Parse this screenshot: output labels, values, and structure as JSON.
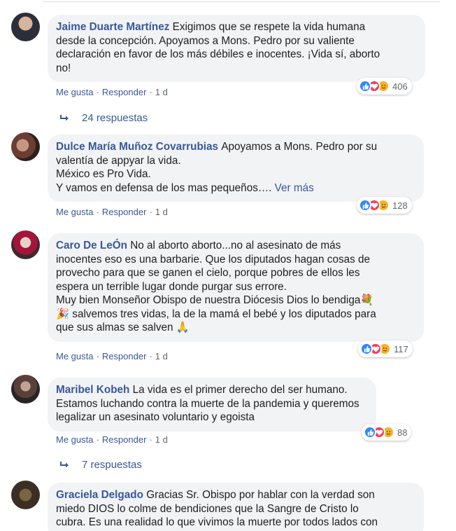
{
  "comments": [
    {
      "author": "Jaime Duarte Martínez",
      "lines": [
        "Exigimos que se respete la vida humana",
        "desde la concepción. Apoyamos a Mons. Pedro por su valiente",
        "declaración en favor de los más débiles e inocentes. ¡Vida sí, aborto",
        "no!"
      ],
      "like_label": "Me gusta",
      "reply_label": "Responder",
      "time": "1 d",
      "reaction_count": "406",
      "replies_label": "24 respuestas"
    },
    {
      "author": "Dulce María Muñoz Covarrubias",
      "lines": [
        "Apoyamos a Mons. Pedro por su",
        "valentía de appyar la vida.",
        "México es Pro Vida.",
        "Y vamos en defensa de los mas pequeños…."
      ],
      "see_more": "Ver más",
      "like_label": "Me gusta",
      "reply_label": "Responder",
      "time": "1 d",
      "reaction_count": "128"
    },
    {
      "author": "Caro De LeÓn",
      "lines": [
        "No al aborto aborto...no al asesinato de más",
        "inocentes eso es una barbarie. Que los diputados hagan cosas de",
        "provecho para que se ganen el cielo, porque pobres de ellos les",
        "espera un terrible lugar donde purgar sus errore.",
        "Muy bien Monseñor Obispo de nuestra Diócesis Dios lo bendiga💐",
        "🎉 salvemos tres vidas, la de la mamá el bebé y los diputados para",
        "que sus almas se salven 🙏"
      ],
      "like_label": "Me gusta",
      "reply_label": "Responder",
      "time": "1 d",
      "reaction_count": "117"
    },
    {
      "author": "Maribel Kobeh",
      "lines": [
        "La vida es el primer derecho del ser humano.",
        "Estamos luchando contra la muerte de la pandemia y queremos",
        "legalizar un asesinato voluntario y egoista"
      ],
      "like_label": "Me gusta",
      "reply_label": "Responder",
      "time": "1 d",
      "reaction_count": "88",
      "replies_label": "7 respuestas"
    },
    {
      "author": "Graciela Delgado",
      "lines": [
        "Gracias Sr. Obispo por hablar con la verdad son",
        "miedo DIOS lo colme de bendiciones que la Sangre de Cristo lo",
        "cubra. Es una realidad lo que vivimos la muerte por todos lados con"
      ]
    }
  ],
  "colors": {
    "link": "#385898",
    "bubble": "#f2f3f5",
    "meta": "#606770",
    "like": "#2d88ff",
    "love": "#f33e58",
    "care": "#f7b125"
  },
  "icons": {
    "reaction_like": "thumbs-up-icon",
    "reaction_love": "heart-icon",
    "reaction_care": "care-icon",
    "reply_arrow": "reply-arrow-icon"
  }
}
